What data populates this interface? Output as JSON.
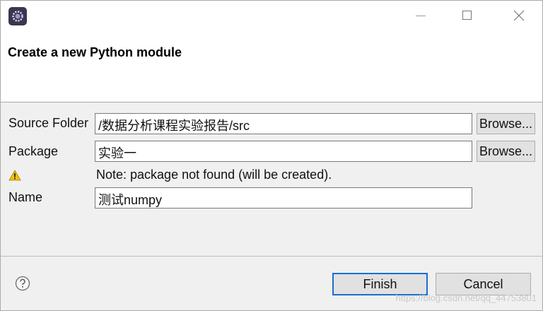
{
  "dialog": {
    "title": "Create a new Python module",
    "colors": {
      "accent": "#1a6fd1",
      "warning": "#f2c200"
    }
  },
  "form": {
    "source_folder": {
      "label": "Source Folder",
      "value": "/数据分析课程实验报告/src",
      "browse_label": "Browse..."
    },
    "package": {
      "label": "Package",
      "value": "实验一",
      "browse_label": "Browse..."
    },
    "note": {
      "icon": "warning-icon",
      "text": "Note: package not found (will be created)."
    },
    "name": {
      "label": "Name",
      "value": "测试numpy"
    }
  },
  "footer": {
    "help_icon": "help-icon",
    "finish_label": "Finish",
    "cancel_label": "Cancel"
  },
  "watermark": "https://blog.csdn.net/qq_44753801"
}
